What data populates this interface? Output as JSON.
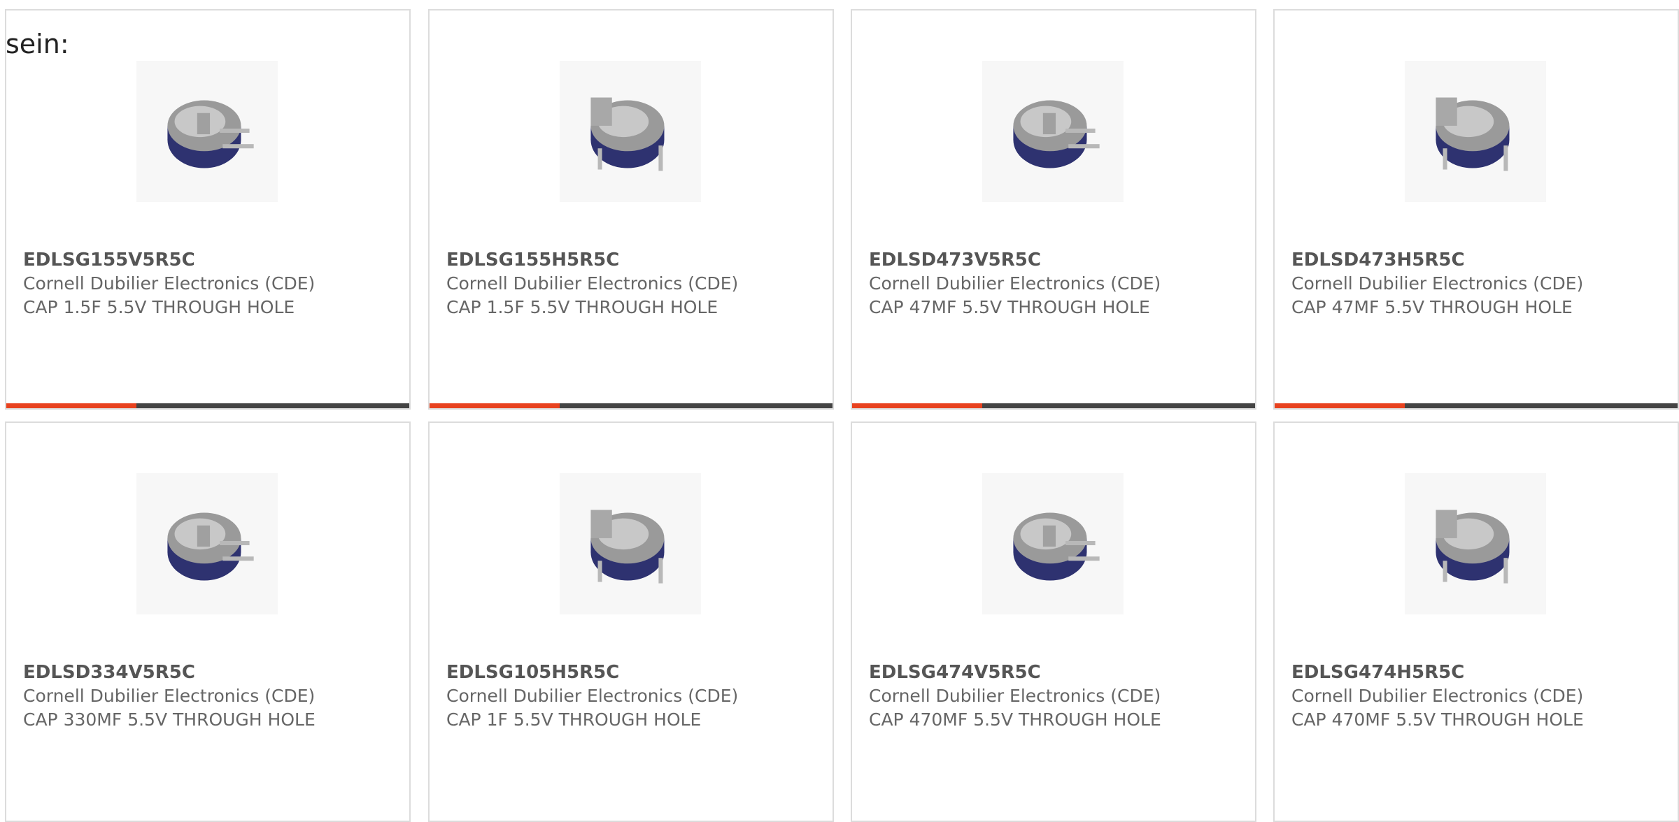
{
  "intro_text": "sein:",
  "colors": {
    "accent": "#e8421f",
    "bar_track": "#444444",
    "card_border": "#dcdcdc",
    "text": "#666666",
    "part_number": "#555555",
    "capacitor_body": "#2e3270",
    "capacitor_top": "#9a9a9a",
    "lead": "#b8b8b8"
  },
  "products": [
    {
      "part_number": "EDLSG155V5R5C",
      "manufacturer": "Cornell Dubilier Electronics (CDE)",
      "description": "CAP 1.5F 5.5V THROUGH HOLE",
      "image_icon": "supercapacitor-vertical-icon",
      "progress": 0.32
    },
    {
      "part_number": "EDLSG155H5R5C",
      "manufacturer": "Cornell Dubilier Electronics (CDE)",
      "description": "CAP 1.5F 5.5V THROUGH HOLE",
      "image_icon": "supercapacitor-horizontal-icon",
      "progress": 0.32
    },
    {
      "part_number": "EDLSD473V5R5C",
      "manufacturer": "Cornell Dubilier Electronics (CDE)",
      "description": "CAP 47MF 5.5V THROUGH HOLE",
      "image_icon": "supercapacitor-vertical-icon",
      "progress": 0.32
    },
    {
      "part_number": "EDLSD473H5R5C",
      "manufacturer": "Cornell Dubilier Electronics (CDE)",
      "description": "CAP 47MF 5.5V THROUGH HOLE",
      "image_icon": "supercapacitor-horizontal-icon",
      "progress": 0.32
    },
    {
      "part_number": "EDLSD334V5R5C",
      "manufacturer": "Cornell Dubilier Electronics (CDE)",
      "description": "CAP 330MF 5.5V THROUGH HOLE",
      "image_icon": "supercapacitor-vertical-icon",
      "progress": null
    },
    {
      "part_number": "EDLSG105H5R5C",
      "manufacturer": "Cornell Dubilier Electronics (CDE)",
      "description": "CAP 1F 5.5V THROUGH HOLE",
      "image_icon": "supercapacitor-horizontal-icon",
      "progress": null
    },
    {
      "part_number": "EDLSG474V5R5C",
      "manufacturer": "Cornell Dubilier Electronics (CDE)",
      "description": "CAP 470MF 5.5V THROUGH HOLE",
      "image_icon": "supercapacitor-vertical-icon",
      "progress": null
    },
    {
      "part_number": "EDLSG474H5R5C",
      "manufacturer": "Cornell Dubilier Electronics (CDE)",
      "description": "CAP 470MF 5.5V THROUGH HOLE",
      "image_icon": "supercapacitor-horizontal-icon",
      "progress": null
    }
  ]
}
